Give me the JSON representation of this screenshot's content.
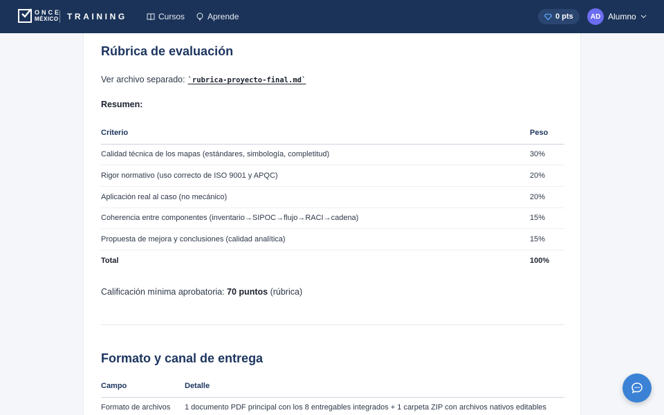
{
  "header": {
    "logo_top": "ONCE",
    "logo_bottom": "MÉXICO",
    "brand": "TRAINING",
    "nav": [
      {
        "label": "Cursos",
        "icon": "book-icon"
      },
      {
        "label": "Aprende",
        "icon": "lightbulb-icon"
      }
    ],
    "points": "0 pts",
    "avatar_initials": "AD",
    "user_name": "Alumno"
  },
  "rubric": {
    "title": "Rúbrica de evaluación",
    "file_prefix": "Ver archivo separado:",
    "file_name": "`rubrica-proyecto-final.md`",
    "summary_label": "Resumen:",
    "columns": [
      "Criterio",
      "Peso"
    ],
    "rows": [
      [
        "Calidad técnica de los mapas (estándares, simbología, completitud)",
        "30%"
      ],
      [
        "Rigor normativo (uso correcto de ISO 9001 y APQC)",
        "20%"
      ],
      [
        "Aplicación real al caso (no mecánico)",
        "20%"
      ],
      [
        "Coherencia entre componentes (inventario→SIPOC→flujo→RACI→cadena)",
        "15%"
      ],
      [
        "Propuesta de mejora y conclusiones (calidad analítica)",
        "15%"
      ]
    ],
    "total": [
      "Total",
      "100%"
    ],
    "minimum_prefix": "Calificación mínima aprobatoria:",
    "minimum_value": "70 puntos",
    "minimum_suffix": "(rúbrica)"
  },
  "delivery": {
    "title": "Formato y canal de entrega",
    "columns": [
      "Campo",
      "Detalle"
    ],
    "rows": [
      [
        "Formato de archivos",
        "1 documento PDF principal con los 8 entregables integrados + 1 carpeta ZIP con archivos nativos editables"
      ]
    ]
  },
  "colors": {
    "header_bg": "#1b3358",
    "heading": "#1c355e",
    "accent": "#3b82d6",
    "avatar": "#6c6cf0"
  }
}
